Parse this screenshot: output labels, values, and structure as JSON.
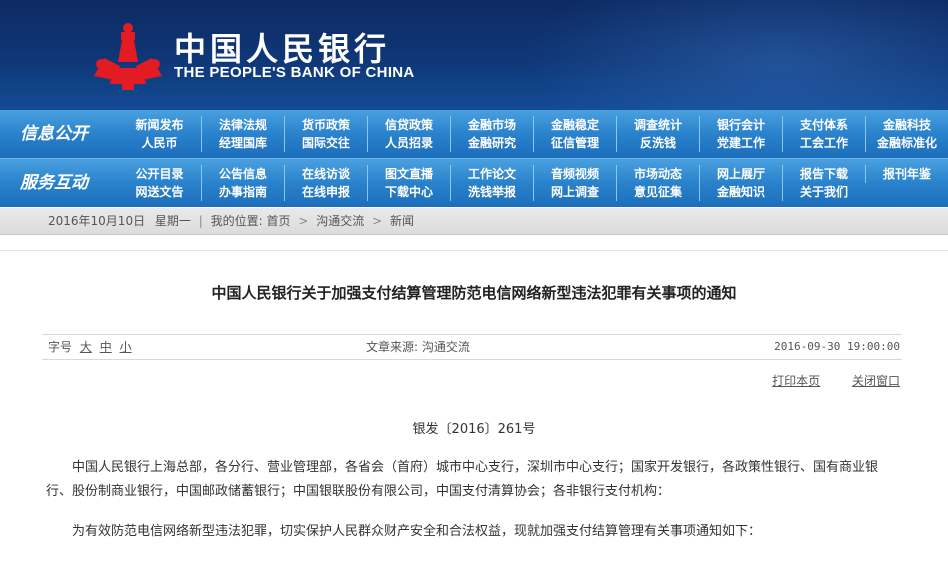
{
  "header": {
    "cn_name": "中国人民银行",
    "en_name": "THE PEOPLE'S BANK OF CHINA",
    "colors": {
      "top": "#0d2a63",
      "emblem": "#e31b23",
      "nav": "#2a82cc"
    }
  },
  "nav_info": {
    "title": "信息公开",
    "links": [
      "新闻发布",
      "法律法规",
      "货币政策",
      "信贷政策",
      "金融市场",
      "金融稳定",
      "调查统计",
      "银行会计",
      "支付体系",
      "金融科技",
      "人民币",
      "经理国库",
      "国际交往",
      "人员招录",
      "金融研究",
      "征信管理",
      "反洗钱",
      "党建工作",
      "工会工作",
      "金融标准化"
    ]
  },
  "nav_service": {
    "title": "服务互动",
    "links": [
      "公开目录",
      "公告信息",
      "在线访谈",
      "图文直播",
      "工作论文",
      "音频视频",
      "市场动态",
      "网上展厅",
      "报告下载",
      "报刊年鉴",
      "网送文告",
      "办事指南",
      "在线申报",
      "下载中心",
      "洗钱举报",
      "网上调查",
      "意见征集",
      "金融知识",
      "关于我们",
      ""
    ]
  },
  "crumbs": {
    "date": "2016年10月10日",
    "weekday": "星期一",
    "location_label": "我的位置:",
    "home": "首页",
    "level1": "沟通交流",
    "level2": "新闻"
  },
  "article": {
    "title": "中国人民银行关于加强支付结算管理防范电信网络新型违法犯罪有关事项的通知",
    "font_label": "字号",
    "font_large": "大",
    "font_medium": "中",
    "font_small": "小",
    "source": "文章来源: 沟通交流",
    "datetime": "2016-09-30 19:00:00",
    "print_label": "打印本页",
    "close_label": "关闭窗口",
    "doc_number": "银发〔2016〕261号",
    "para1": "中国人民银行上海总部，各分行、营业管理部，各省会（首府）城市中心支行，深圳市中心支行；国家开发银行，各政策性银行、国有商业银行、股份制商业银行，中国邮政储蓄银行；中国银联股份有限公司，中国支付清算协会；各非银行支付机构：",
    "para2": "为有效防范电信网络新型违法犯罪，切实保护人民群众财产安全和合法权益，现就加强支付结算管理有关事项通知如下："
  }
}
